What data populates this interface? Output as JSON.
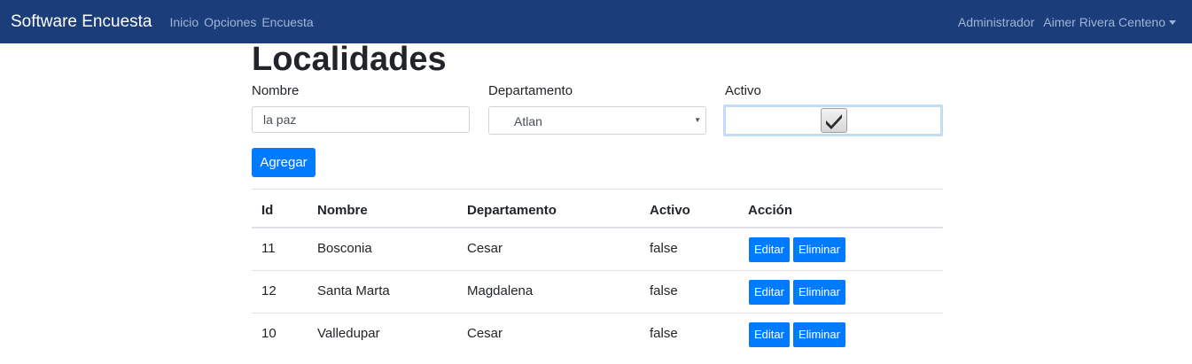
{
  "navbar": {
    "brand": "Software Encuesta",
    "links": [
      "Inicio",
      "Opciones",
      "Encuesta"
    ],
    "role": "Administrador",
    "user": "Aimer Rivera Centeno"
  },
  "page": {
    "title": "Localidades"
  },
  "form": {
    "nombre_label": "Nombre",
    "nombre_value": "la paz",
    "departamento_label": "Departamento",
    "departamento_selected": "Atlan",
    "activo_label": "Activo",
    "activo_checked": true,
    "submit_label": "Agregar"
  },
  "table": {
    "headers": [
      "Id",
      "Nombre",
      "Departamento",
      "Activo",
      "Acción"
    ],
    "rows": [
      {
        "id": "11",
        "nombre": "Bosconia",
        "departamento": "Cesar",
        "activo": "false"
      },
      {
        "id": "12",
        "nombre": "Santa Marta",
        "departamento": "Magdalena",
        "activo": "false"
      },
      {
        "id": "10",
        "nombre": "Valledupar",
        "departamento": "Cesar",
        "activo": "false"
      }
    ],
    "edit_label": "Editar",
    "delete_label": "Eliminar"
  },
  "colors": {
    "navbar": "#1b3e7b",
    "primary": "#007bff"
  }
}
